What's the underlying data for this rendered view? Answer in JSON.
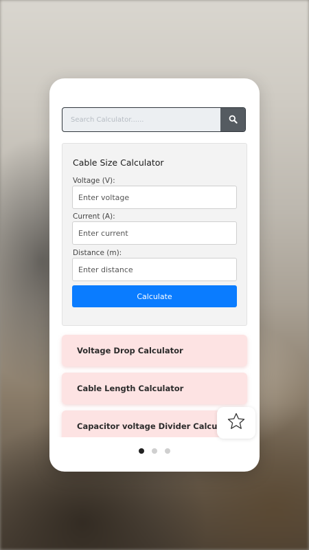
{
  "search": {
    "placeholder": "Search Calculator......",
    "value": ""
  },
  "calculator": {
    "title": "Cable Size Calculator",
    "fields": [
      {
        "label": "Voltage (V):",
        "placeholder": "Enter voltage",
        "value": ""
      },
      {
        "label": "Current (A):",
        "placeholder": "Enter current",
        "value": ""
      },
      {
        "label": "Distance (m):",
        "placeholder": "Enter distance",
        "value": ""
      }
    ],
    "button_label": "Calculate"
  },
  "list": {
    "items": [
      {
        "label": "Voltage Drop Calculator"
      },
      {
        "label": "Cable Length Calculator"
      },
      {
        "label": "Capacitor voltage Divider Calculator"
      }
    ]
  },
  "pagination": {
    "total": 3,
    "active": 1
  },
  "icons": {
    "search": "search-icon",
    "favorite": "star-outline-icon"
  },
  "colors": {
    "primary_button": "#0a7cff",
    "list_item_bg": "#fde3e3",
    "search_button": "#555b61"
  }
}
